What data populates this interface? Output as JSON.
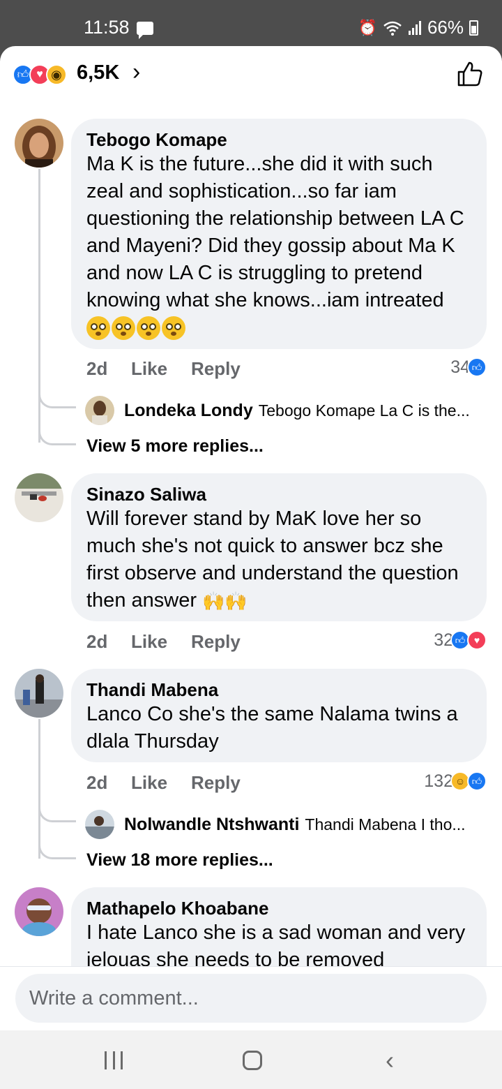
{
  "status_bar": {
    "time": "11:58",
    "battery": "66%"
  },
  "reactions_header": {
    "count": "6,5K"
  },
  "comments": [
    {
      "author": "Tebogo Komape",
      "text": "Ma K is the future...she did it with such zeal and sophistication...so far iam questioning the relationship between LA C and Mayeni? Did they gossip about Ma K and now LA C is struggling to pretend knowing what she knows...iam intreated",
      "time": "2d",
      "like_label": "Like",
      "reply_label": "Reply",
      "reaction_count": "34",
      "reply_preview": {
        "author": "Londeka Londy",
        "text": "Tebogo Komape  La C is the..."
      },
      "view_more": "View 5 more replies..."
    },
    {
      "author": "Sinazo Saliwa",
      "text": "Will forever stand by MaK love her so much she's not quick to answer bcz she first observe and understand the question then answer",
      "time": "2d",
      "like_label": "Like",
      "reply_label": "Reply",
      "reaction_count": "32"
    },
    {
      "author": "Thandi Mabena",
      "text": "Lanco Co she's the same Nalama twins a dlala Thursday",
      "time": "2d",
      "like_label": "Like",
      "reply_label": "Reply",
      "reaction_count": "132",
      "reply_preview": {
        "author": "Nolwandle Ntshwanti",
        "text": "Thandi Mabena I tho..."
      },
      "view_more": "View 18 more replies..."
    },
    {
      "author": "Mathapelo Khoabane",
      "text": "I hate Lanco she is a sad woman and very jelouas she needs to be removed"
    }
  ],
  "composer": {
    "placeholder": "Write a comment..."
  },
  "icons": {
    "like": "thumbs-up-icon",
    "love": "heart-icon",
    "wow": "wow-icon",
    "haha": "laugh-icon"
  },
  "colors": {
    "facebook_blue": "#1877f2",
    "love_red": "#f33e58",
    "bubble_gray": "#f0f2f5"
  }
}
